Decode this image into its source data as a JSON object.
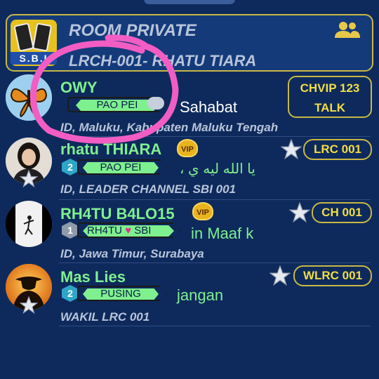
{
  "room": {
    "title": "ROOM PRIVATE",
    "subtitle": "LRCH-001- RHATU TIARA",
    "logo_text": "S.B.I",
    "icon": "people-icon"
  },
  "users": [
    {
      "name": "OWY",
      "badge": "PAO PEI",
      "status": "Sahabat",
      "location": "ID, Maluku, Kabupaten Maluku Tengah",
      "chip_line1": "CHVIP 123",
      "chip_line2": "TALK"
    },
    {
      "name": "rhatu THIARA",
      "vip": "VIP",
      "level": "2",
      "badge": "PAO PEI",
      "status": "، يا الله    ليه ي",
      "location": "ID, LEADER CHANNEL SBI 001",
      "role": "LRC 001"
    },
    {
      "name": "RH4TU B4LO15",
      "vip": "VIP",
      "level": "1",
      "badge": "RH4TU",
      "badge_suffix": "SBI",
      "status": "in       Maaf k",
      "location": "ID, Jawa Timur, Surabaya",
      "role": "CH 001"
    },
    {
      "name": "Mas Lies",
      "level": "2",
      "badge": "PUSING",
      "status": "jangan",
      "location": "WAKIL LRC 001",
      "role": "WLRC 001"
    }
  ],
  "colors": {
    "background": "#0e2a5c",
    "name_green": "#7ff08f",
    "gold_border": "#c9b845",
    "gold_text": "#f1dd45",
    "annotation": "#f25dc4"
  }
}
